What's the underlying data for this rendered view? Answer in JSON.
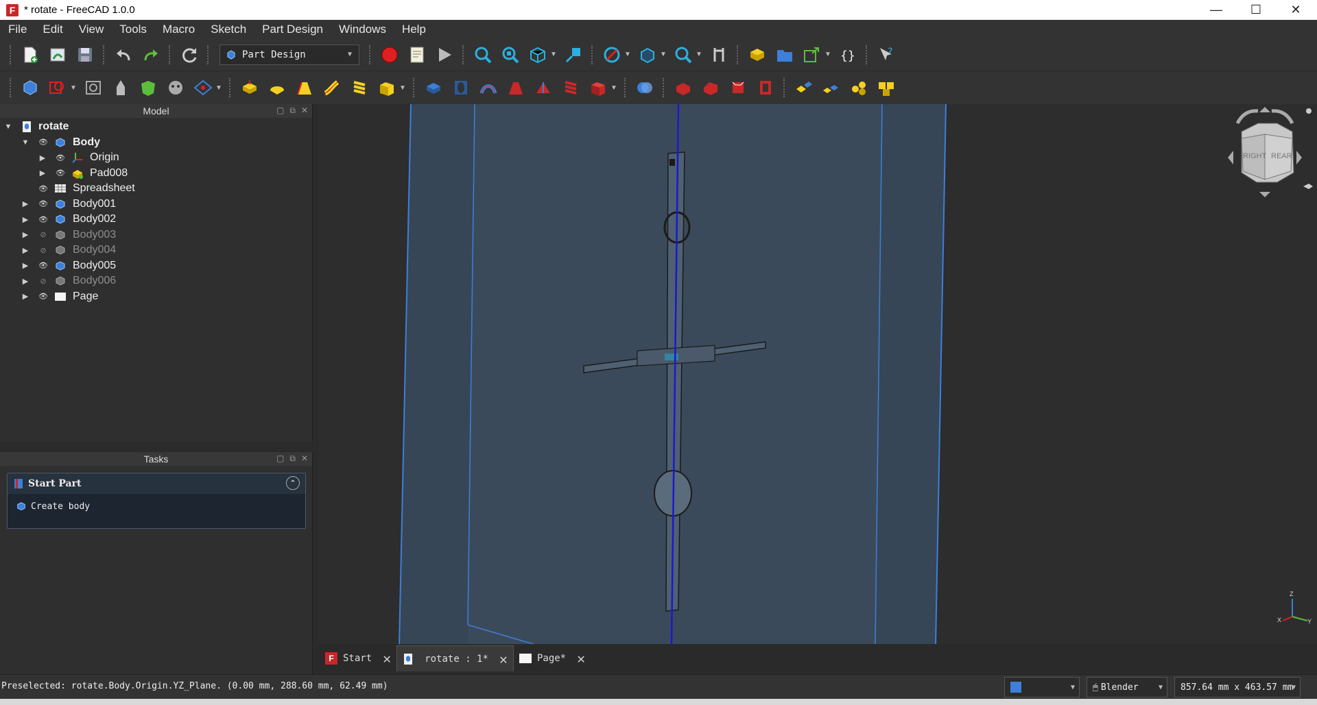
{
  "window": {
    "title": "* rotate - FreeCAD 1.0.0",
    "logo_letter": "F",
    "minimize": "—",
    "maximize": "☐",
    "close": "✕"
  },
  "menu": [
    "File",
    "Edit",
    "View",
    "Tools",
    "Macro",
    "Sketch",
    "Part Design",
    "Windows",
    "Help"
  ],
  "workbench": {
    "selected": "Part Design"
  },
  "model_panel": {
    "title": "Model",
    "tree": [
      {
        "label": "rotate",
        "bold": true,
        "hidden": false
      },
      {
        "label": "Body",
        "bold": true,
        "hidden": false
      },
      {
        "label": "Origin",
        "bold": false,
        "hidden": false
      },
      {
        "label": "Pad008",
        "bold": false,
        "hidden": false
      },
      {
        "label": "Spreadsheet",
        "bold": false,
        "hidden": false
      },
      {
        "label": "Body001",
        "bold": false,
        "hidden": false
      },
      {
        "label": "Body002",
        "bold": false,
        "hidden": false
      },
      {
        "label": "Body003",
        "bold": false,
        "hidden": true
      },
      {
        "label": "Body004",
        "bold": false,
        "hidden": true
      },
      {
        "label": "Body005",
        "bold": false,
        "hidden": false
      },
      {
        "label": "Body006",
        "bold": false,
        "hidden": true
      },
      {
        "label": "Page",
        "bold": false,
        "hidden": false
      }
    ]
  },
  "tasks_panel": {
    "title": "Tasks",
    "box_title": "Start Part",
    "action": "Create body"
  },
  "navcube": {
    "right_label": "RIGHT",
    "rear_label": "REAR"
  },
  "axes": {
    "z": "Z",
    "x": "X",
    "y": "Y"
  },
  "tabs": [
    {
      "label": "Start",
      "active": false
    },
    {
      "label": "rotate : 1*",
      "active": true
    },
    {
      "label": "Page*",
      "active": false
    }
  ],
  "status": {
    "message": "Preselected: rotate.Body.Origin.YZ_Plane. (0.00 mm, 288.60 mm, 62.49 mm)",
    "nav_style": "Blender",
    "dimensions": "857.64 mm x 463.57 mm"
  },
  "colors": {
    "accent_blue": "#3d7fd9",
    "plane_fill": "#3b4a5a",
    "record_red": "#e02020"
  }
}
